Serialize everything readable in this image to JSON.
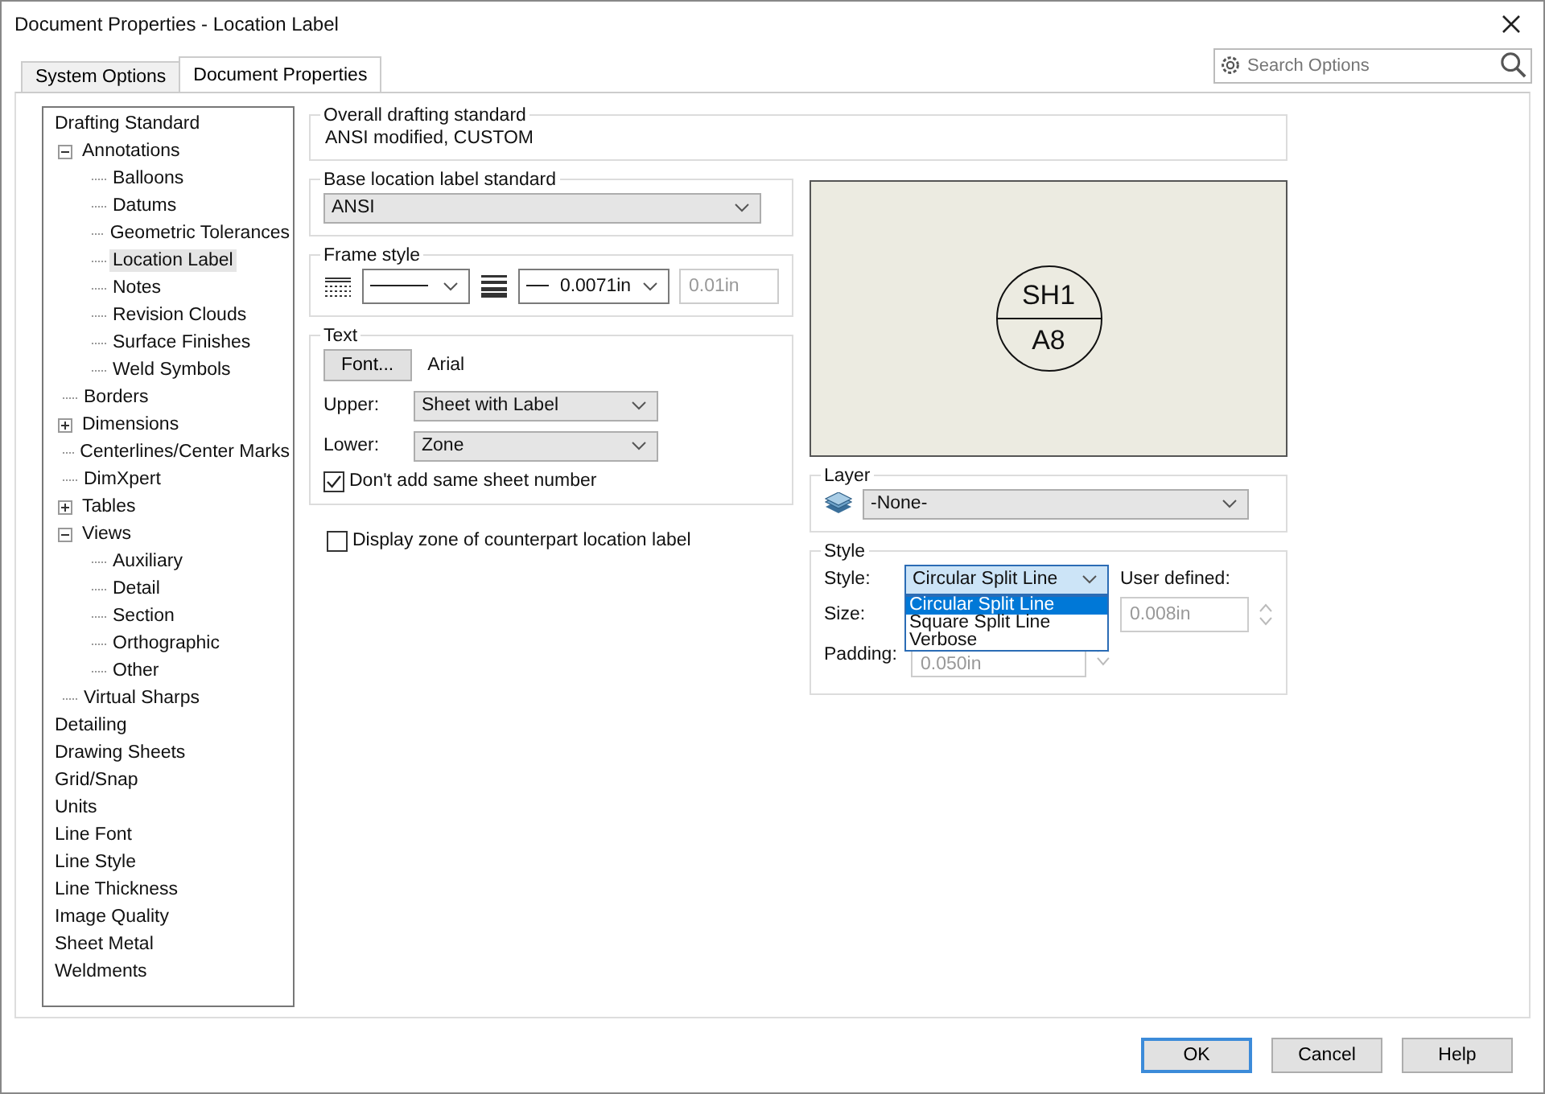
{
  "window": {
    "title": "Document Properties - Location Label"
  },
  "tabs": [
    {
      "label": "System Options",
      "selected": false
    },
    {
      "label": "Document Properties",
      "selected": true
    }
  ],
  "search": {
    "placeholder": "Search Options"
  },
  "tree": [
    {
      "label": "Drafting Standard",
      "selected": false,
      "children": [
        {
          "label": "Annotations",
          "selected": false,
          "expanded": true,
          "children": [
            {
              "label": "Balloons",
              "selected": false
            },
            {
              "label": "Datums",
              "selected": false
            },
            {
              "label": "Geometric Tolerances",
              "selected": false
            },
            {
              "label": "Location Label",
              "selected": true
            },
            {
              "label": "Notes",
              "selected": false
            },
            {
              "label": "Revision Clouds",
              "selected": false
            },
            {
              "label": "Surface Finishes",
              "selected": false
            },
            {
              "label": "Weld Symbols",
              "selected": false
            }
          ]
        },
        {
          "label": "Borders",
          "selected": false
        },
        {
          "label": "Dimensions",
          "selected": false,
          "expanded": false
        },
        {
          "label": "Centerlines/Center Marks",
          "selected": false
        },
        {
          "label": "DimXpert",
          "selected": false
        },
        {
          "label": "Tables",
          "selected": false,
          "expanded": false
        },
        {
          "label": "Views",
          "selected": false,
          "expanded": true,
          "children": [
            {
              "label": "Auxiliary",
              "selected": false
            },
            {
              "label": "Detail",
              "selected": false
            },
            {
              "label": "Section",
              "selected": false
            },
            {
              "label": "Orthographic",
              "selected": false
            },
            {
              "label": "Other",
              "selected": false
            }
          ]
        },
        {
          "label": "Virtual Sharps",
          "selected": false
        }
      ]
    },
    {
      "label": "Detailing",
      "selected": false
    },
    {
      "label": "Drawing Sheets",
      "selected": false
    },
    {
      "label": "Grid/Snap",
      "selected": false
    },
    {
      "label": "Units",
      "selected": false
    },
    {
      "label": "Line Font",
      "selected": false
    },
    {
      "label": "Line Style",
      "selected": false
    },
    {
      "label": "Line Thickness",
      "selected": false
    },
    {
      "label": "Image Quality",
      "selected": false
    },
    {
      "label": "Sheet Metal",
      "selected": false
    },
    {
      "label": "Weldments",
      "selected": false
    }
  ],
  "overall": {
    "title": "Overall drafting standard",
    "value": "ANSI modified, CUSTOM"
  },
  "base_standard": {
    "title": "Base location label standard",
    "value": "ANSI"
  },
  "frame_style": {
    "title": "Frame style",
    "thickness": "0.0071in",
    "custom_thickness": "0.01in"
  },
  "text": {
    "title": "Text",
    "font_button": "Font...",
    "font_name": "Arial",
    "upper_label": "Upper:",
    "upper_value": "Sheet with Label",
    "lower_label": "Lower:",
    "lower_value": "Zone",
    "same_sheet": {
      "label": "Don't add same sheet number",
      "checked": true
    }
  },
  "display_zone": {
    "label": "Display zone of counterpart location label",
    "checked": false
  },
  "preview": {
    "upper": "SH1",
    "lower": "A8"
  },
  "layer": {
    "title": "Layer",
    "value": "-None-"
  },
  "style": {
    "title": "Style",
    "style_label": "Style:",
    "style_value": "Circular Split Line",
    "options": [
      {
        "label": "Circular Split Line",
        "selected": true
      },
      {
        "label": "Square Split Line",
        "selected": false
      },
      {
        "label": "Verbose",
        "selected": false
      }
    ],
    "size_label": "Size:",
    "user_defined_label": "User defined:",
    "user_defined_value": "0.008in",
    "padding_label": "Padding:",
    "padding_value": "0.050in"
  },
  "buttons": [
    {
      "label": "OK",
      "default": true
    },
    {
      "label": "Cancel",
      "default": false
    },
    {
      "label": "Help",
      "default": false
    }
  ]
}
